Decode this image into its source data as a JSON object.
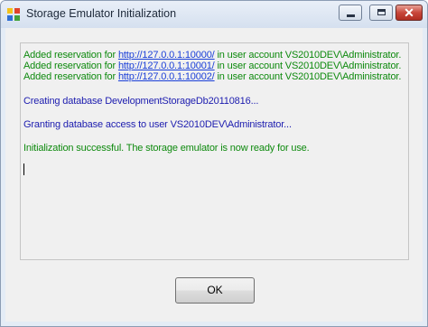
{
  "window": {
    "title": "Storage Emulator Initialization",
    "close_glyph": "✕"
  },
  "log": {
    "lines": [
      {
        "prefix": "Added reservation for ",
        "link": "http://127.0.0.1:10000/",
        "suffix": " in user account VS2010DEV\\Administrator."
      },
      {
        "prefix": "Added reservation for ",
        "link": "http://127.0.0.1:10001/",
        "suffix": " in user account VS2010DEV\\Administrator."
      },
      {
        "prefix": "Added reservation for ",
        "link": "http://127.0.0.1:10002/",
        "suffix": " in user account VS2010DEV\\Administrator."
      }
    ],
    "creating_db": "Creating database DevelopmentStorageDb20110816...",
    "granting_access": "Granting database access to user VS2010DEV\\Administrator...",
    "success": "Initialization successful. The storage emulator is now ready for use."
  },
  "buttons": {
    "ok_label": "OK"
  },
  "colors": {
    "success_text": "#0e8a0e",
    "info_text": "#1c1caf",
    "link": "#1a3fd8"
  },
  "icons": {
    "app": "storage-emulator-icon",
    "minimize": "minimize-icon",
    "maximize": "maximize-icon",
    "close": "close-icon"
  }
}
